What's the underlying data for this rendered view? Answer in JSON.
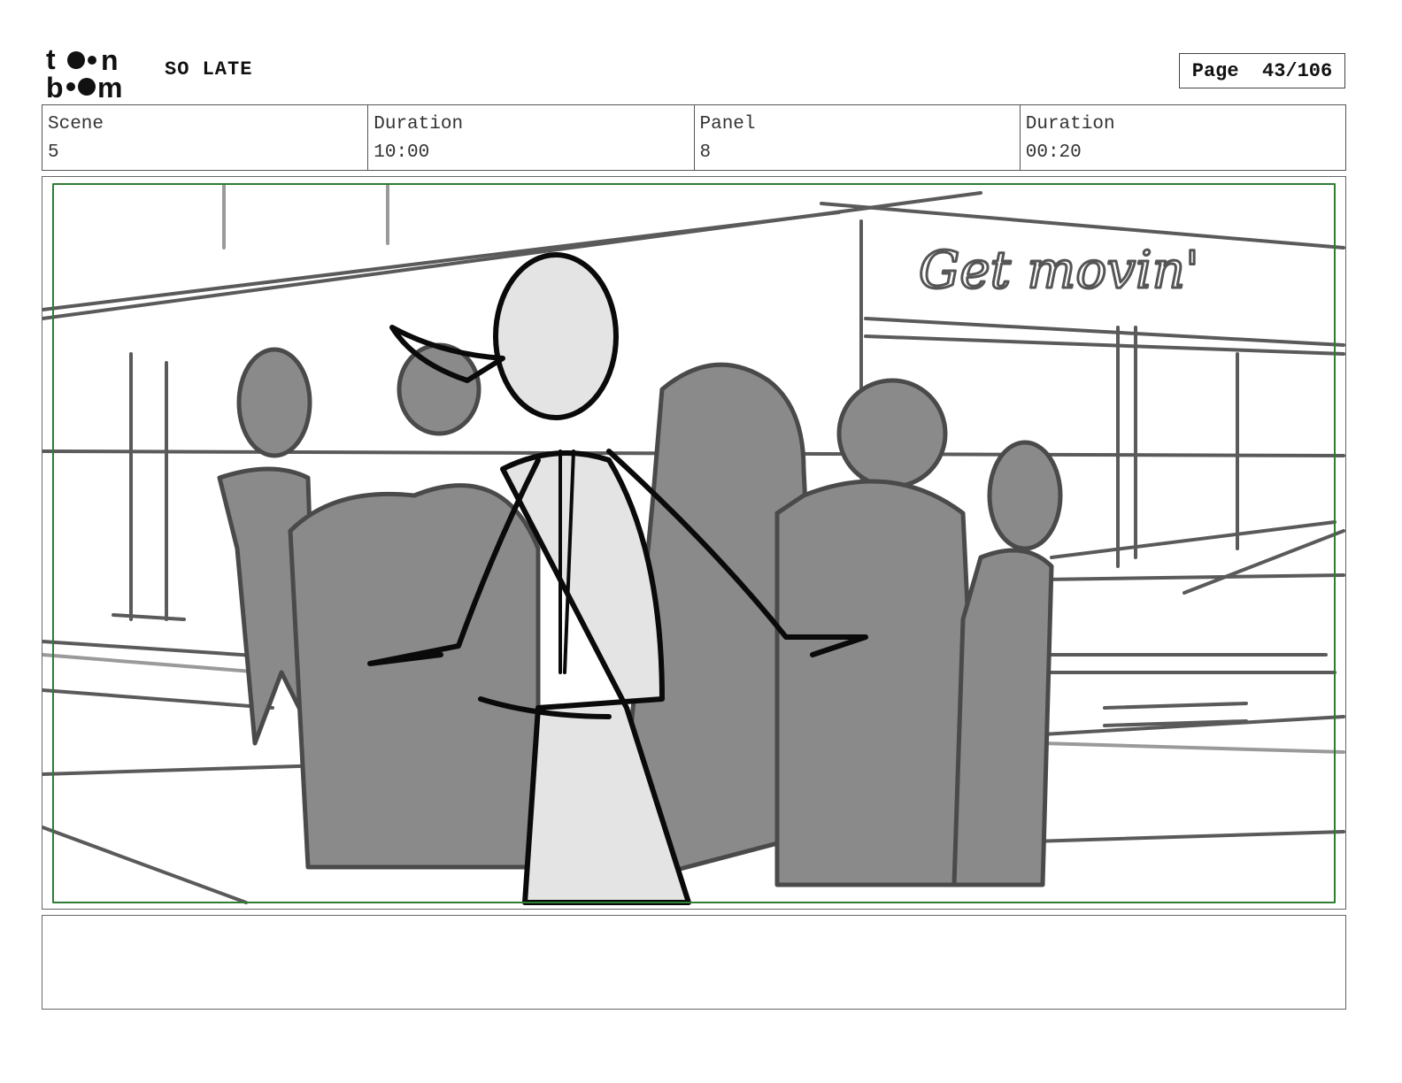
{
  "header": {
    "logo_text": "toon boom",
    "project_title": "SO LATE",
    "page_label": "Page",
    "page_number": "43/106"
  },
  "info": {
    "scene_label": "Scene",
    "scene_value": "5",
    "scene_duration_label": "Duration",
    "scene_duration_value": "10:00",
    "panel_label": "Panel",
    "panel_value": "8",
    "panel_duration_label": "Duration",
    "panel_duration_value": "00:20"
  },
  "panel": {
    "sign_text": "Get movin'",
    "safe_frame_color": "#2e7d32",
    "crowd_color": "#8a8a8a",
    "character_fill": "#e4e4e4"
  },
  "notes": {
    "text": ""
  }
}
